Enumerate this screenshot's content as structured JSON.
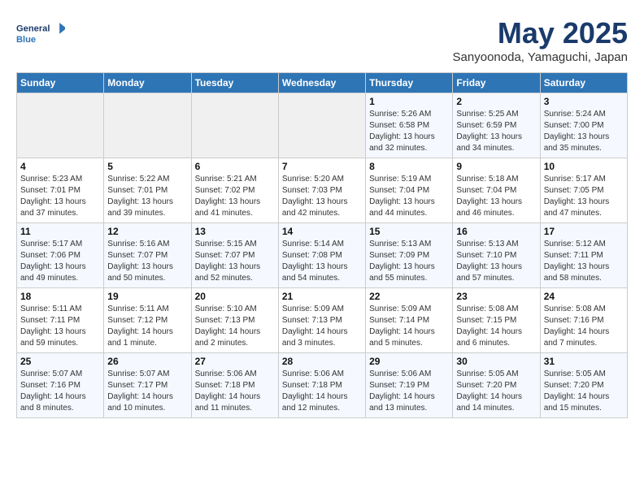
{
  "header": {
    "logo_line1": "General",
    "logo_line2": "Blue",
    "month_title": "May 2025",
    "subtitle": "Sanyoonoda, Yamaguchi, Japan"
  },
  "days_of_week": [
    "Sunday",
    "Monday",
    "Tuesday",
    "Wednesday",
    "Thursday",
    "Friday",
    "Saturday"
  ],
  "weeks": [
    [
      {
        "day": "",
        "info": ""
      },
      {
        "day": "",
        "info": ""
      },
      {
        "day": "",
        "info": ""
      },
      {
        "day": "",
        "info": ""
      },
      {
        "day": "1",
        "info": "Sunrise: 5:26 AM\nSunset: 6:58 PM\nDaylight: 13 hours\nand 32 minutes."
      },
      {
        "day": "2",
        "info": "Sunrise: 5:25 AM\nSunset: 6:59 PM\nDaylight: 13 hours\nand 34 minutes."
      },
      {
        "day": "3",
        "info": "Sunrise: 5:24 AM\nSunset: 7:00 PM\nDaylight: 13 hours\nand 35 minutes."
      }
    ],
    [
      {
        "day": "4",
        "info": "Sunrise: 5:23 AM\nSunset: 7:01 PM\nDaylight: 13 hours\nand 37 minutes."
      },
      {
        "day": "5",
        "info": "Sunrise: 5:22 AM\nSunset: 7:01 PM\nDaylight: 13 hours\nand 39 minutes."
      },
      {
        "day": "6",
        "info": "Sunrise: 5:21 AM\nSunset: 7:02 PM\nDaylight: 13 hours\nand 41 minutes."
      },
      {
        "day": "7",
        "info": "Sunrise: 5:20 AM\nSunset: 7:03 PM\nDaylight: 13 hours\nand 42 minutes."
      },
      {
        "day": "8",
        "info": "Sunrise: 5:19 AM\nSunset: 7:04 PM\nDaylight: 13 hours\nand 44 minutes."
      },
      {
        "day": "9",
        "info": "Sunrise: 5:18 AM\nSunset: 7:04 PM\nDaylight: 13 hours\nand 46 minutes."
      },
      {
        "day": "10",
        "info": "Sunrise: 5:17 AM\nSunset: 7:05 PM\nDaylight: 13 hours\nand 47 minutes."
      }
    ],
    [
      {
        "day": "11",
        "info": "Sunrise: 5:17 AM\nSunset: 7:06 PM\nDaylight: 13 hours\nand 49 minutes."
      },
      {
        "day": "12",
        "info": "Sunrise: 5:16 AM\nSunset: 7:07 PM\nDaylight: 13 hours\nand 50 minutes."
      },
      {
        "day": "13",
        "info": "Sunrise: 5:15 AM\nSunset: 7:07 PM\nDaylight: 13 hours\nand 52 minutes."
      },
      {
        "day": "14",
        "info": "Sunrise: 5:14 AM\nSunset: 7:08 PM\nDaylight: 13 hours\nand 54 minutes."
      },
      {
        "day": "15",
        "info": "Sunrise: 5:13 AM\nSunset: 7:09 PM\nDaylight: 13 hours\nand 55 minutes."
      },
      {
        "day": "16",
        "info": "Sunrise: 5:13 AM\nSunset: 7:10 PM\nDaylight: 13 hours\nand 57 minutes."
      },
      {
        "day": "17",
        "info": "Sunrise: 5:12 AM\nSunset: 7:11 PM\nDaylight: 13 hours\nand 58 minutes."
      }
    ],
    [
      {
        "day": "18",
        "info": "Sunrise: 5:11 AM\nSunset: 7:11 PM\nDaylight: 13 hours\nand 59 minutes."
      },
      {
        "day": "19",
        "info": "Sunrise: 5:11 AM\nSunset: 7:12 PM\nDaylight: 14 hours\nand 1 minute."
      },
      {
        "day": "20",
        "info": "Sunrise: 5:10 AM\nSunset: 7:13 PM\nDaylight: 14 hours\nand 2 minutes."
      },
      {
        "day": "21",
        "info": "Sunrise: 5:09 AM\nSunset: 7:13 PM\nDaylight: 14 hours\nand 3 minutes."
      },
      {
        "day": "22",
        "info": "Sunrise: 5:09 AM\nSunset: 7:14 PM\nDaylight: 14 hours\nand 5 minutes."
      },
      {
        "day": "23",
        "info": "Sunrise: 5:08 AM\nSunset: 7:15 PM\nDaylight: 14 hours\nand 6 minutes."
      },
      {
        "day": "24",
        "info": "Sunrise: 5:08 AM\nSunset: 7:16 PM\nDaylight: 14 hours\nand 7 minutes."
      }
    ],
    [
      {
        "day": "25",
        "info": "Sunrise: 5:07 AM\nSunset: 7:16 PM\nDaylight: 14 hours\nand 8 minutes."
      },
      {
        "day": "26",
        "info": "Sunrise: 5:07 AM\nSunset: 7:17 PM\nDaylight: 14 hours\nand 10 minutes."
      },
      {
        "day": "27",
        "info": "Sunrise: 5:06 AM\nSunset: 7:18 PM\nDaylight: 14 hours\nand 11 minutes."
      },
      {
        "day": "28",
        "info": "Sunrise: 5:06 AM\nSunset: 7:18 PM\nDaylight: 14 hours\nand 12 minutes."
      },
      {
        "day": "29",
        "info": "Sunrise: 5:06 AM\nSunset: 7:19 PM\nDaylight: 14 hours\nand 13 minutes."
      },
      {
        "day": "30",
        "info": "Sunrise: 5:05 AM\nSunset: 7:20 PM\nDaylight: 14 hours\nand 14 minutes."
      },
      {
        "day": "31",
        "info": "Sunrise: 5:05 AM\nSunset: 7:20 PM\nDaylight: 14 hours\nand 15 minutes."
      }
    ]
  ]
}
